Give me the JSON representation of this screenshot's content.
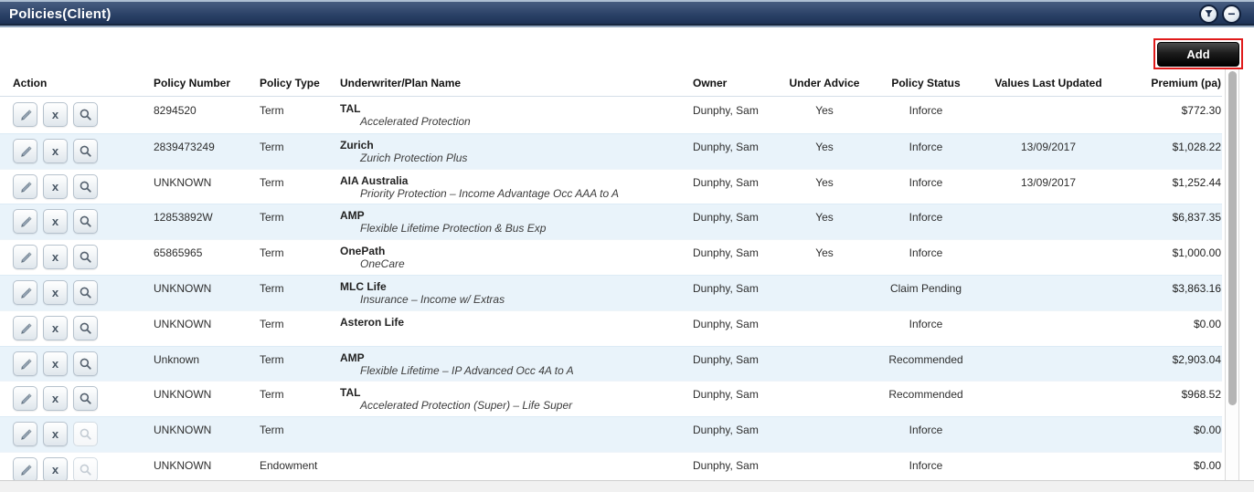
{
  "panel": {
    "title": "Policies(Client)"
  },
  "toolbar": {
    "add_label": "Add",
    "highlight_color": "#e01b1b"
  },
  "icons": {
    "titlebar": [
      {
        "name": "filter-icon",
        "glyph": "funnel"
      },
      {
        "name": "collapse-icon",
        "glyph": "−"
      }
    ],
    "row_actions": [
      {
        "name": "edit-pencil-icon",
        "glyph": "pencil"
      },
      {
        "name": "delete-x-icon",
        "glyph": "x"
      },
      {
        "name": "search-magnifier-icon",
        "glyph": "magnifier"
      }
    ]
  },
  "colors": {
    "titlebar_navy_top": "#475d80",
    "titlebar_navy_bottom": "#1c3053",
    "row_alt_blue": "#e9f3fa",
    "add_button_bg": "#000000",
    "annotation_red": "#e01b1b"
  },
  "table": {
    "columns": [
      {
        "label": "Action",
        "align": "left"
      },
      {
        "label": "Policy Number",
        "align": "left"
      },
      {
        "label": "Policy Type",
        "align": "left"
      },
      {
        "label": "Underwriter/Plan Name",
        "align": "left"
      },
      {
        "label": "Owner",
        "align": "left"
      },
      {
        "label": "Under Advice",
        "align": "center"
      },
      {
        "label": "Policy Status",
        "align": "center"
      },
      {
        "label": "Values Last Updated",
        "align": "center"
      },
      {
        "label": "Premium (pa)",
        "align": "right"
      }
    ],
    "action_labels": {
      "delete": "x"
    },
    "rows": [
      {
        "policy_number": "8294520",
        "policy_type": "Term",
        "underwriter": "TAL",
        "plan": "Accelerated Protection",
        "owner": "Dunphy, Sam",
        "under_advice": "Yes",
        "policy_status": "Inforce",
        "values_last_updated": "",
        "premium": "$772.30",
        "search_enabled": true
      },
      {
        "policy_number": "2839473249",
        "policy_type": "Term",
        "underwriter": "Zurich",
        "plan": "Zurich Protection Plus",
        "owner": "Dunphy, Sam",
        "under_advice": "Yes",
        "policy_status": "Inforce",
        "values_last_updated": "13/09/2017",
        "premium": "$1,028.22",
        "search_enabled": true
      },
      {
        "policy_number": "UNKNOWN",
        "policy_type": "Term",
        "underwriter": "AIA Australia",
        "plan": "Priority Protection – Income Advantage Occ AAA to A",
        "owner": "Dunphy, Sam",
        "under_advice": "Yes",
        "policy_status": "Inforce",
        "values_last_updated": "13/09/2017",
        "premium": "$1,252.44",
        "search_enabled": true
      },
      {
        "policy_number": "12853892W",
        "policy_type": "Term",
        "underwriter": "AMP",
        "plan": "Flexible Lifetime Protection & Bus Exp",
        "owner": "Dunphy, Sam",
        "under_advice": "Yes",
        "policy_status": "Inforce",
        "values_last_updated": "",
        "premium": "$6,837.35",
        "search_enabled": true
      },
      {
        "policy_number": "65865965",
        "policy_type": "Term",
        "underwriter": "OnePath",
        "plan": "OneCare",
        "owner": "Dunphy, Sam",
        "under_advice": "Yes",
        "policy_status": "Inforce",
        "values_last_updated": "",
        "premium": "$1,000.00",
        "search_enabled": true
      },
      {
        "policy_number": "UNKNOWN",
        "policy_type": "Term",
        "underwriter": "MLC Life",
        "plan": "Insurance – Income w/ Extras",
        "owner": "Dunphy, Sam",
        "under_advice": "",
        "policy_status": "Claim Pending",
        "values_last_updated": "",
        "premium": "$3,863.16",
        "search_enabled": true
      },
      {
        "policy_number": "UNKNOWN",
        "policy_type": "Term",
        "underwriter": "Asteron Life",
        "plan": "",
        "owner": "Dunphy, Sam",
        "under_advice": "",
        "policy_status": "Inforce",
        "values_last_updated": "",
        "premium": "$0.00",
        "search_enabled": true
      },
      {
        "policy_number": "Unknown",
        "policy_type": "Term",
        "underwriter": "AMP",
        "plan": "Flexible Lifetime – IP Advanced Occ 4A to A",
        "owner": "Dunphy, Sam",
        "under_advice": "",
        "policy_status": "Recommended",
        "values_last_updated": "",
        "premium": "$2,903.04",
        "search_enabled": true
      },
      {
        "policy_number": "UNKNOWN",
        "policy_type": "Term",
        "underwriter": "TAL",
        "plan": "Accelerated Protection (Super) – Life Super",
        "owner": "Dunphy, Sam",
        "under_advice": "",
        "policy_status": "Recommended",
        "values_last_updated": "",
        "premium": "$968.52",
        "search_enabled": true
      },
      {
        "policy_number": "UNKNOWN",
        "policy_type": "Term",
        "underwriter": "",
        "plan": "",
        "owner": "Dunphy, Sam",
        "under_advice": "",
        "policy_status": "Inforce",
        "values_last_updated": "",
        "premium": "$0.00",
        "search_enabled": false
      },
      {
        "policy_number": "UNKNOWN",
        "policy_type": "Endowment",
        "underwriter": "",
        "plan": "",
        "owner": "Dunphy, Sam",
        "under_advice": "",
        "policy_status": "Inforce",
        "values_last_updated": "",
        "premium": "$0.00",
        "search_enabled": false
      }
    ]
  }
}
